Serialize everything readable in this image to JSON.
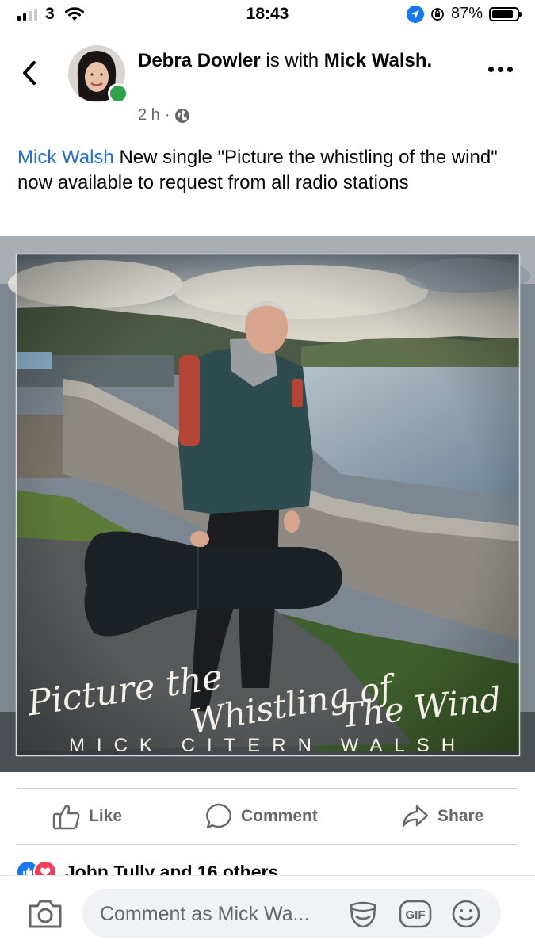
{
  "status_bar": {
    "carrier": "3",
    "time": "18:43",
    "battery_percent": "87%",
    "battery_level": 0.87
  },
  "header": {
    "author": "Debra Dowler",
    "with_text": "is with",
    "tagged": "Mick Walsh.",
    "time_ago": "2 h",
    "separator": "·",
    "audience_icon": "globe-icon"
  },
  "post": {
    "mention": "Mick Walsh",
    "text": "New single \"Picture the whistling of the wind\" now available to request from all radio stations"
  },
  "cover": {
    "title_line1": "Picture the",
    "title_line2": "Whistling of",
    "title_line3": "The Wind",
    "artist": "MICK CITERN WALSH"
  },
  "actions": {
    "like": "Like",
    "comment": "Comment",
    "share": "Share"
  },
  "reactions": {
    "summary": "John Tully and 16 others"
  },
  "comment_bar": {
    "placeholder": "Comment as Mick Wa...",
    "gif_label": "GIF"
  },
  "colors": {
    "brand_blue": "#1877f2",
    "mention_blue": "#216fdb",
    "online_green": "#31a24c",
    "love_red": "#f33e58",
    "secondary_text": "#65676b"
  }
}
